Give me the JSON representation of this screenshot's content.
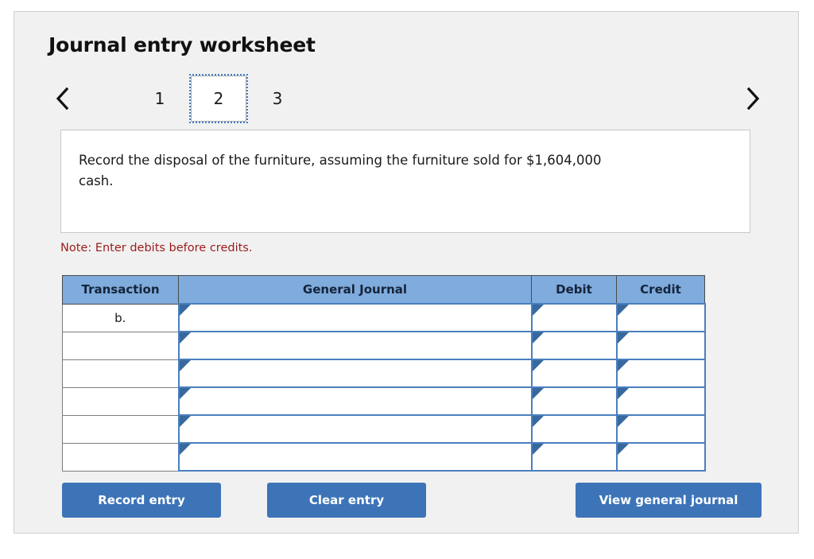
{
  "page": {
    "title": "Journal entry worksheet"
  },
  "pager": {
    "prev_icon": "chevron-left-icon",
    "next_icon": "chevron-right-icon",
    "pages": [
      {
        "label": "1",
        "active": false
      },
      {
        "label": "2",
        "active": true
      },
      {
        "label": "3",
        "active": false
      }
    ]
  },
  "question": {
    "text": "Record the disposal of the furniture, assuming the furniture sold for $1,604,000 cash."
  },
  "note": {
    "text": "Note: Enter debits before credits."
  },
  "table": {
    "headers": {
      "transaction": "Transaction",
      "general_journal": "General Journal",
      "debit": "Debit",
      "credit": "Credit"
    },
    "rows": [
      {
        "transaction": "b.",
        "general_journal": "",
        "debit": "",
        "credit": ""
      },
      {
        "transaction": "",
        "general_journal": "",
        "debit": "",
        "credit": ""
      },
      {
        "transaction": "",
        "general_journal": "",
        "debit": "",
        "credit": ""
      },
      {
        "transaction": "",
        "general_journal": "",
        "debit": "",
        "credit": ""
      },
      {
        "transaction": "",
        "general_journal": "",
        "debit": "",
        "credit": ""
      },
      {
        "transaction": "",
        "general_journal": "",
        "debit": "",
        "credit": ""
      }
    ]
  },
  "buttons": {
    "record_entry": "Record entry",
    "clear_entry": "Clear entry",
    "view_general_journal": "View general journal"
  },
  "colors": {
    "panel_background": "#f1f1f1",
    "header_blue": "#7fabdd",
    "button_blue": "#3d74b8",
    "note_red": "#9b1b1b",
    "cell_border_blue": "#4a7fbd",
    "active_tab_border": "#3e7ac0"
  }
}
